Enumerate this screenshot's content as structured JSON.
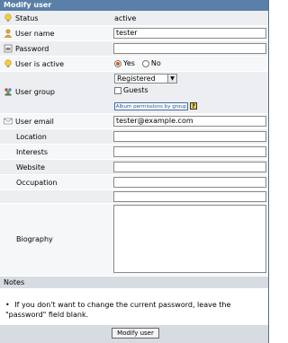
{
  "title": "Modify user",
  "fields": {
    "status": {
      "label": "Status",
      "value": "active",
      "icon": "lightbulb-icon"
    },
    "username": {
      "label": "User name",
      "value": "tester",
      "icon": "user-icon"
    },
    "password": {
      "label": "Password",
      "value": "",
      "icon": "password-icon"
    },
    "active": {
      "label": "User is active",
      "yes": "Yes",
      "no": "No",
      "selected": "Yes",
      "icon": "lightbulb-icon"
    },
    "group": {
      "label": "User group",
      "selected": "Registered",
      "guests_label": "Guests",
      "perm_button": "Album permissions by group",
      "icon": "group-icon"
    },
    "email": {
      "label": "User email",
      "value": "tester@example.com",
      "icon": "email-icon"
    },
    "location": {
      "label": "Location",
      "value": ""
    },
    "interests": {
      "label": "Interests",
      "value": ""
    },
    "website": {
      "label": "Website",
      "value": ""
    },
    "occupation": {
      "label": "Occupation",
      "value": ""
    },
    "biography": {
      "label": "Biography",
      "value": ""
    }
  },
  "notes": {
    "heading": "Notes",
    "text": "If you don't want to change the current password, leave the \"password\" field blank."
  },
  "submit": "Modify user",
  "colors": {
    "header": "#5a7fa8",
    "row_alt": "#eceef1",
    "footer": "#d7dbe2"
  }
}
